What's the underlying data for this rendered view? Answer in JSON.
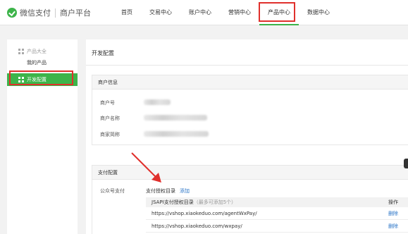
{
  "header": {
    "brand": "微信支付",
    "brand_sub": "商户平台",
    "nav": [
      {
        "label": "首页"
      },
      {
        "label": "交易中心"
      },
      {
        "label": "账户中心"
      },
      {
        "label": "营销中心"
      },
      {
        "label": "产品中心",
        "active": true
      },
      {
        "label": "数据中心"
      }
    ]
  },
  "sidebar": {
    "group_label": "产品大全",
    "sub_item": "我的产品",
    "active_item": "开发配置"
  },
  "main": {
    "title": "开发配置",
    "merchant": {
      "section_title": "商户信息",
      "fields": [
        {
          "label": "商户号"
        },
        {
          "label": "商户名称"
        },
        {
          "label": "商家简称"
        }
      ]
    },
    "payment": {
      "section_title": "支付配置",
      "jsapi_label": "公众号支付",
      "auth_dir_label": "支付授权目录",
      "add_label": "添加",
      "table": {
        "col_dir": "JSAPI支付授权目录",
        "col_dir_hint": "（最多可添加5个）",
        "col_op": "操作",
        "rows": [
          {
            "url": "https://vshop.xiaokeduo.com/agentWxPay/",
            "action": "删除"
          },
          {
            "url": "https://vshop.xiaokeduo.com/wxpay/",
            "action": "删除"
          }
        ]
      }
    }
  },
  "colors": {
    "brand_green": "#3db44a",
    "highlight_red": "#e0302c",
    "link_blue": "#2a74c7"
  }
}
